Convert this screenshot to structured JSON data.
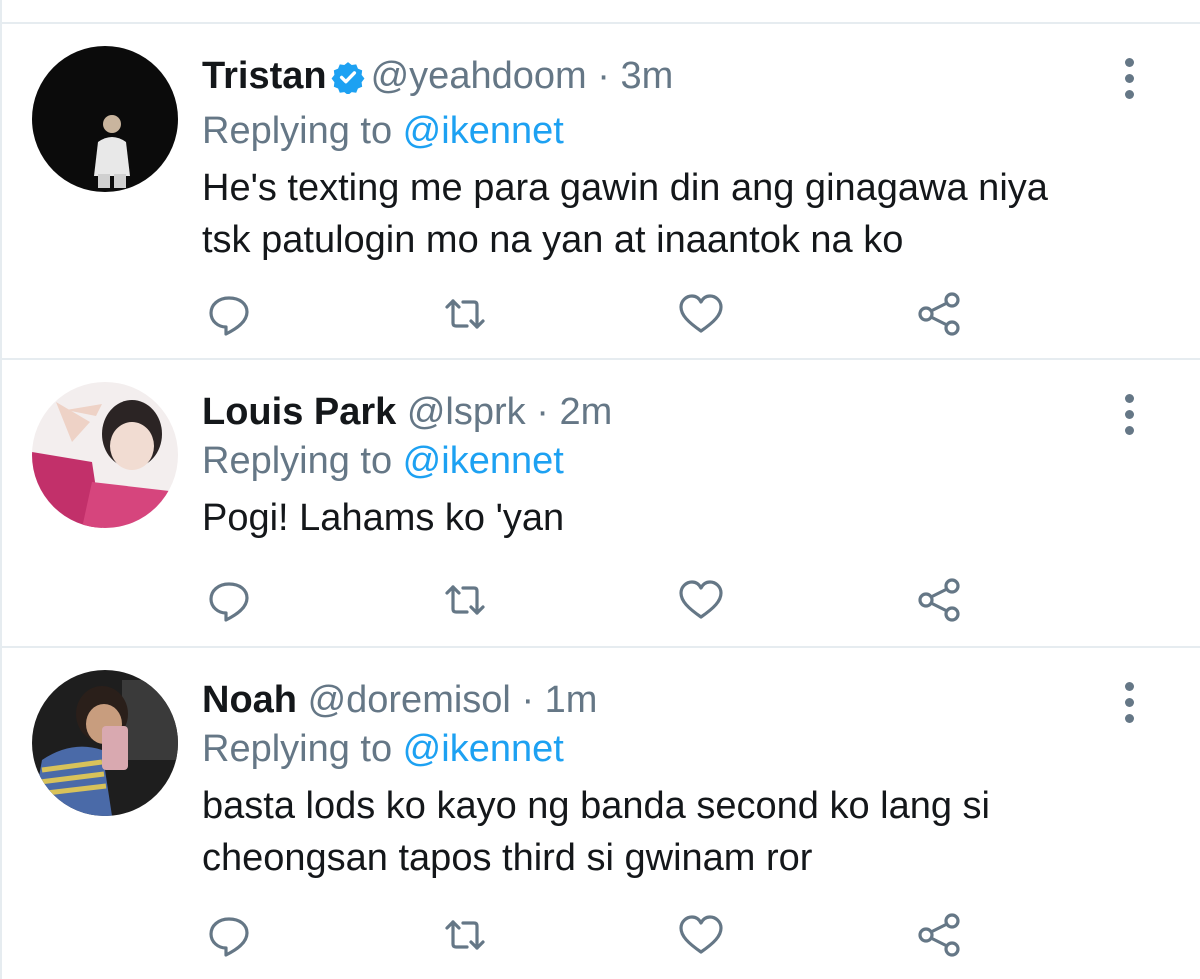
{
  "tweets": [
    {
      "display_name": "Tristan",
      "verified": true,
      "handle": "@yeahdoom",
      "separator": "·",
      "time": "3m",
      "replying_prefix": "Replying to ",
      "replying_to": "@ikennet",
      "text_lines": [
        "He's texting me para gawin din ang ginagawa niya",
        "tsk patulogin mo na yan at inaantok na ko"
      ]
    },
    {
      "display_name": "Louis Park",
      "verified": false,
      "handle": "@lsprk",
      "separator": "·",
      "time": "2m",
      "replying_prefix": "Replying to ",
      "replying_to": "@ikennet",
      "text_lines": [
        "Pogi! Lahams ko 'yan"
      ]
    },
    {
      "display_name": "Noah",
      "verified": false,
      "handle": "@doremisol",
      "separator": "·",
      "time": "1m",
      "replying_prefix": "Replying to ",
      "replying_to": "@ikennet",
      "text_lines": [
        "basta lods ko kayo ng banda second ko lang si",
        "cheongsan tapos third si gwinam ror"
      ]
    }
  ],
  "icons": {
    "reply": "reply-icon",
    "retweet": "retweet-icon",
    "like": "heart-icon",
    "share": "share-icon",
    "more": "more-vertical-icon",
    "verified": "verified-badge-icon"
  },
  "colors": {
    "accent": "#1da1f2",
    "secondary_text": "#657786",
    "primary_text": "#14171a",
    "divider": "#e6ecf0"
  }
}
